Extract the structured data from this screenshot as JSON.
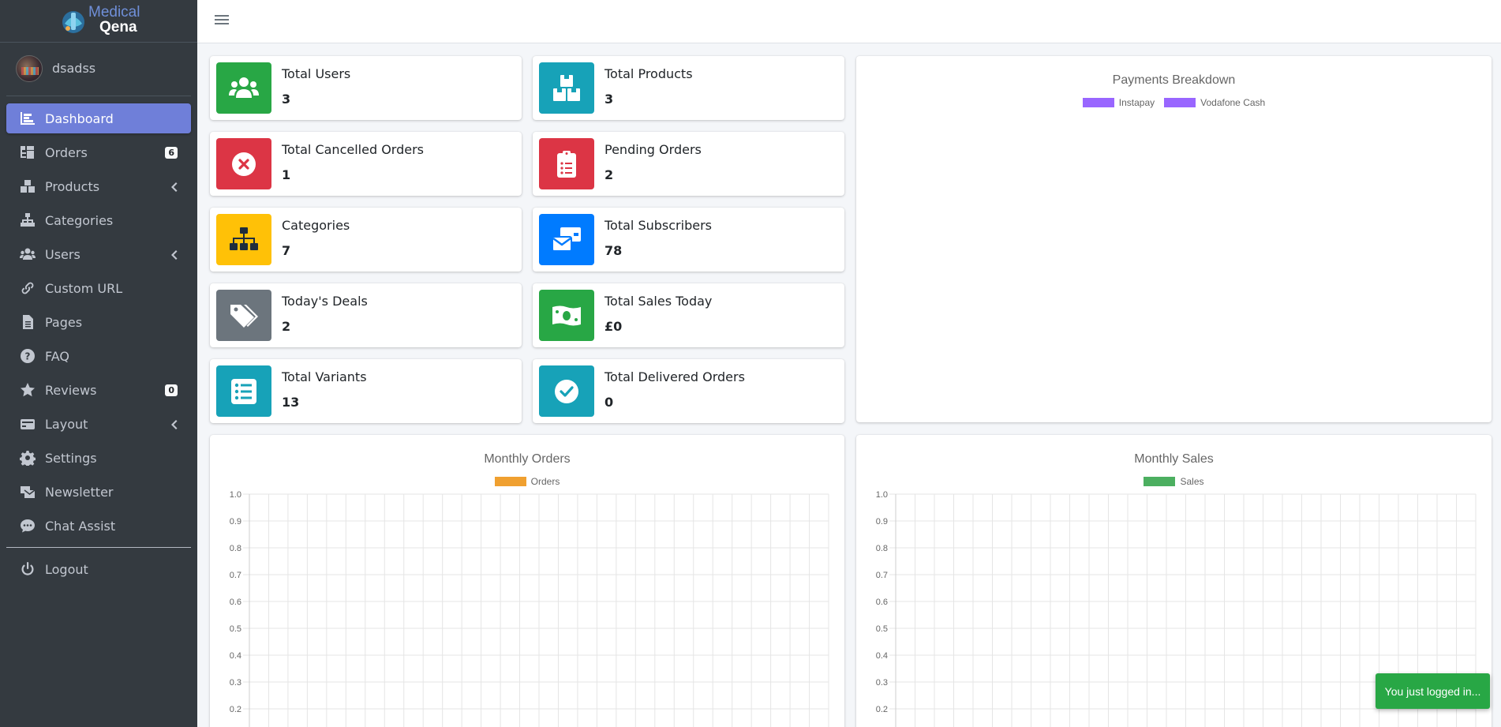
{
  "brand": {
    "line1": "Medical",
    "line2": "Qena"
  },
  "user": {
    "name": "dsadss"
  },
  "sidebar": {
    "items": [
      {
        "label": "Dashboard",
        "icon": "dashboard-icon",
        "active": true
      },
      {
        "label": "Orders",
        "icon": "orders-icon",
        "badge": "6"
      },
      {
        "label": "Products",
        "icon": "products-icon",
        "chevron": true
      },
      {
        "label": "Categories",
        "icon": "categories-icon"
      },
      {
        "label": "Users",
        "icon": "users-icon",
        "chevron": true
      },
      {
        "label": "Custom URL",
        "icon": "link-icon"
      },
      {
        "label": "Pages",
        "icon": "file-icon"
      },
      {
        "label": "FAQ",
        "icon": "question-icon"
      },
      {
        "label": "Reviews",
        "icon": "star-icon",
        "badge": "0"
      },
      {
        "label": "Layout",
        "icon": "layout-icon",
        "chevron": true
      },
      {
        "label": "Settings",
        "icon": "gear-icon"
      },
      {
        "label": "Newsletter",
        "icon": "newsletter-icon"
      },
      {
        "label": "Chat Assist",
        "icon": "chat-icon"
      }
    ],
    "logout": {
      "label": "Logout",
      "icon": "power-icon"
    }
  },
  "stats": [
    {
      "label": "Total Users",
      "value": "3",
      "color": "#28a745",
      "icon": "users-icon"
    },
    {
      "label": "Total Products",
      "value": "3",
      "color": "#17a2b8",
      "icon": "boxes-icon"
    },
    {
      "label": "Total Cancelled Orders",
      "value": "1",
      "color": "#dc3545",
      "icon": "cancel-icon"
    },
    {
      "label": "Pending Orders",
      "value": "2",
      "color": "#dc3545",
      "icon": "clipboard-list-icon"
    },
    {
      "label": "Categories",
      "value": "7",
      "color": "#ffc107",
      "icon": "sitemap-icon"
    },
    {
      "label": "Total Subscribers",
      "value": "78",
      "color": "#007bff",
      "icon": "envelopes-icon"
    },
    {
      "label": "Today's Deals",
      "value": "2",
      "color": "#6c757d",
      "icon": "tags-icon"
    },
    {
      "label": "Total Sales Today",
      "value": "£0",
      "color": "#28a745",
      "icon": "money-bill-icon"
    },
    {
      "label": "Total Variants",
      "value": "13",
      "color": "#17a2b8",
      "icon": "list-icon"
    },
    {
      "label": "Total Delivered Orders",
      "value": "0",
      "color": "#17a2b8",
      "icon": "check-circle-icon"
    }
  ],
  "chart_data": [
    {
      "type": "pie",
      "title": "Payments Breakdown",
      "series": [
        {
          "name": "Instapay",
          "color": "#9966ff"
        },
        {
          "name": "Vodafone Cash",
          "color": "#9966ff"
        }
      ],
      "values": []
    },
    {
      "type": "bar",
      "title": "Monthly Orders",
      "series": [
        {
          "name": "Orders",
          "color": "#f0a030",
          "values": []
        }
      ],
      "yticks": [
        "1.0",
        "0.9",
        "0.8",
        "0.7",
        "0.6",
        "0.5",
        "0.4",
        "0.3",
        "0.2"
      ],
      "ylim": [
        0,
        1.0
      ],
      "grid": true
    },
    {
      "type": "bar",
      "title": "Monthly Sales",
      "series": [
        {
          "name": "Sales",
          "color": "#4caf60",
          "values": []
        }
      ],
      "yticks": [
        "1.0",
        "0.9",
        "0.8",
        "0.7",
        "0.6",
        "0.5",
        "0.4",
        "0.3",
        "0.2"
      ],
      "ylim": [
        0,
        1.0
      ],
      "grid": true
    }
  ],
  "toast": {
    "message": "You just logged in..."
  }
}
